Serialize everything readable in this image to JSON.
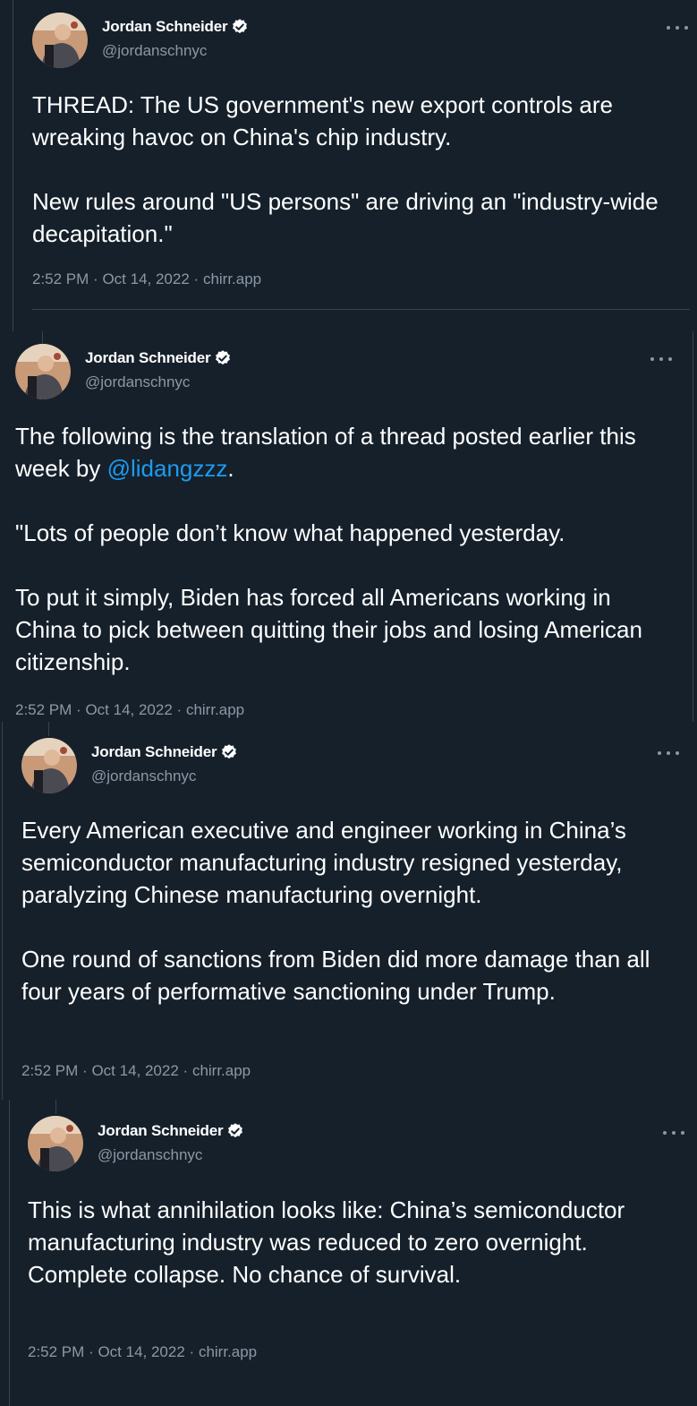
{
  "author": {
    "display_name": "Jordan Schneider",
    "handle": "@jordanschnyc",
    "verified": true
  },
  "colors": {
    "background": "#15202b",
    "text": "#ffffff",
    "muted": "#8b98a5",
    "link": "#1d9bf0",
    "border": "#38444d"
  },
  "tweets": [
    {
      "paragraphs": [
        "THREAD: The US government's new export controls are wreaking havoc on China's chip industry.",
        "New rules around \"US persons\" are driving an \"industry-wide decapitation.\""
      ],
      "time": "2:52 PM",
      "date": "Oct 14, 2022",
      "source": "chirr.app"
    },
    {
      "paragraphs": [
        "The following is the translation of a thread posted earlier this week by ",
        "\"Lots of people don’t know what happened yesterday.",
        "To put it simply, Biden has forced all Americans working in China to pick between quitting their jobs and losing American citizenship."
      ],
      "mention": "@lidangzzz",
      "mention_suffix": ".",
      "time": "2:52 PM",
      "date": "Oct 14, 2022",
      "source": "chirr.app"
    },
    {
      "paragraphs": [
        "Every American executive and engineer working in China’s semiconductor manufacturing industry resigned yesterday, paralyzing Chinese manufacturing overnight.",
        "One round of sanctions from Biden did more damage than all four years of performative sanctioning under Trump."
      ],
      "time": "2:52 PM",
      "date": "Oct 14, 2022",
      "source": "chirr.app"
    },
    {
      "paragraphs": [
        "This is what annihilation looks like: China’s semiconductor manufacturing industry was reduced to zero overnight. Complete collapse. No chance of survival."
      ],
      "time": "2:52 PM",
      "date": "Oct 14, 2022",
      "source": "chirr.app"
    }
  ],
  "meta_separator": "·",
  "icons": {
    "verified": "verified-badge-icon",
    "more": "more-options-icon",
    "avatar": "profile-photo"
  }
}
